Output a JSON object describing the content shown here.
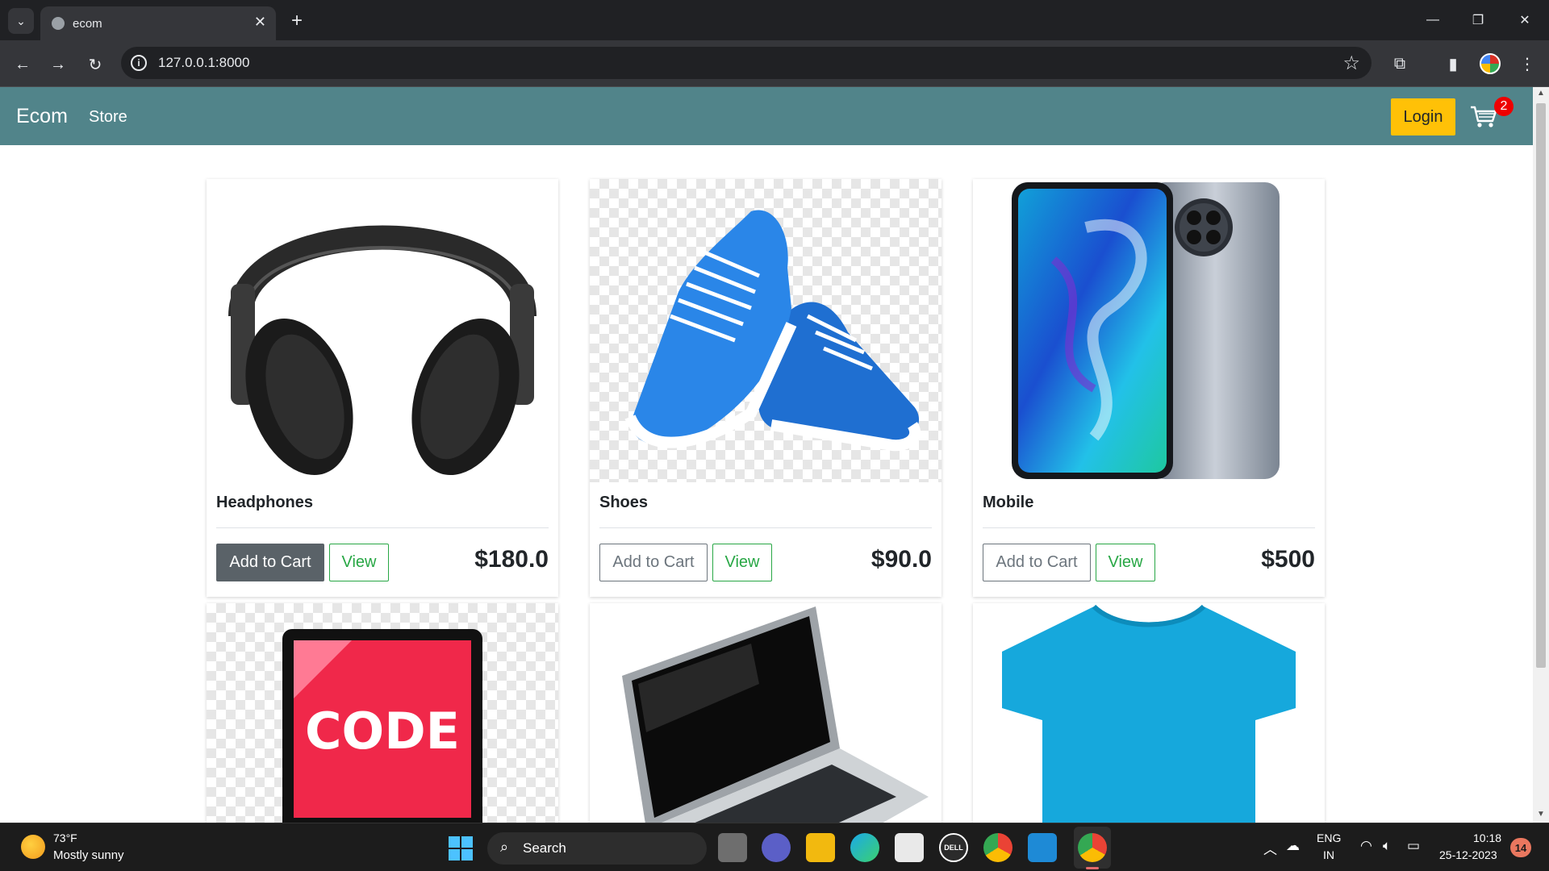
{
  "browser": {
    "tab_title": "ecom",
    "url": "127.0.0.1:8000",
    "new_tab_symbol": "+",
    "close_symbol": "✕"
  },
  "site": {
    "brand": "Ecom",
    "nav_store": "Store",
    "login_label": "Login",
    "cart_count": "2",
    "colors": {
      "navbar": "#51848a",
      "login": "#ffc107",
      "view_border": "#28a745"
    }
  },
  "products": [
    {
      "name": "Headphones",
      "add_label": "Add to Cart",
      "view_label": "View",
      "price": "$180.0",
      "image": "headphones-image"
    },
    {
      "name": "Shoes",
      "add_label": "Add to Cart",
      "view_label": "View",
      "price": "$90.0",
      "image": "shoes-image"
    },
    {
      "name": "Mobile",
      "add_label": "Add to Cart",
      "view_label": "View",
      "price": "$500",
      "image": "mobile-image"
    },
    {
      "image": "code-image",
      "image_text": "CODE"
    },
    {
      "image": "laptop-image"
    },
    {
      "image": "tshirt-image"
    }
  ],
  "taskbar": {
    "weather_temp": "73°F",
    "weather_desc": "Mostly sunny",
    "search_label": "Search",
    "lang_top": "ENG",
    "lang_bottom": "IN",
    "time": "10:18",
    "date": "25-12-2023",
    "notification_count": "14"
  }
}
